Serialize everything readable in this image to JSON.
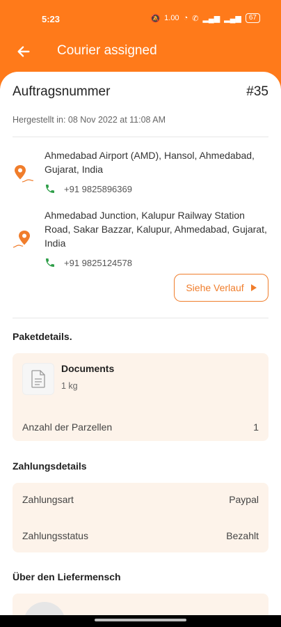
{
  "status": {
    "time": "5:23",
    "net_speed": "1.00 KB/s",
    "battery": "67",
    "color": "#ff7a1a"
  },
  "header": {
    "title": "Courier assigned"
  },
  "order": {
    "label": "Auftragsnummer",
    "number": "#35",
    "created": "Hergestellt in: 08 Nov 2022 at 11:08 AM"
  },
  "pickup": {
    "address": "Ahmedabad Airport (AMD), Hansol, Ahmedabad, Gujarat, India",
    "phone": "+91 9825896369"
  },
  "dropoff": {
    "address": "Ahmedabad Junction, Kalupur Railway Station Road, Sakar Bazzar, Kalupur, Ahmedabad, Gujarat, India",
    "phone": "+91 9825124578"
  },
  "history_button": "Siehe Verlauf",
  "package": {
    "section": "Paketdetails.",
    "name": "Documents",
    "weight": "1 kg",
    "parcels_label": "Anzahl der Parzellen",
    "parcels_value": "1"
  },
  "payment": {
    "section": "Zahlungsdetails",
    "method_label": "Zahlungsart",
    "method_value": "Paypal",
    "status_label": "Zahlungsstatus",
    "status_value": "Bezahlt"
  },
  "courier": {
    "section": "Über den Liefermensch"
  }
}
